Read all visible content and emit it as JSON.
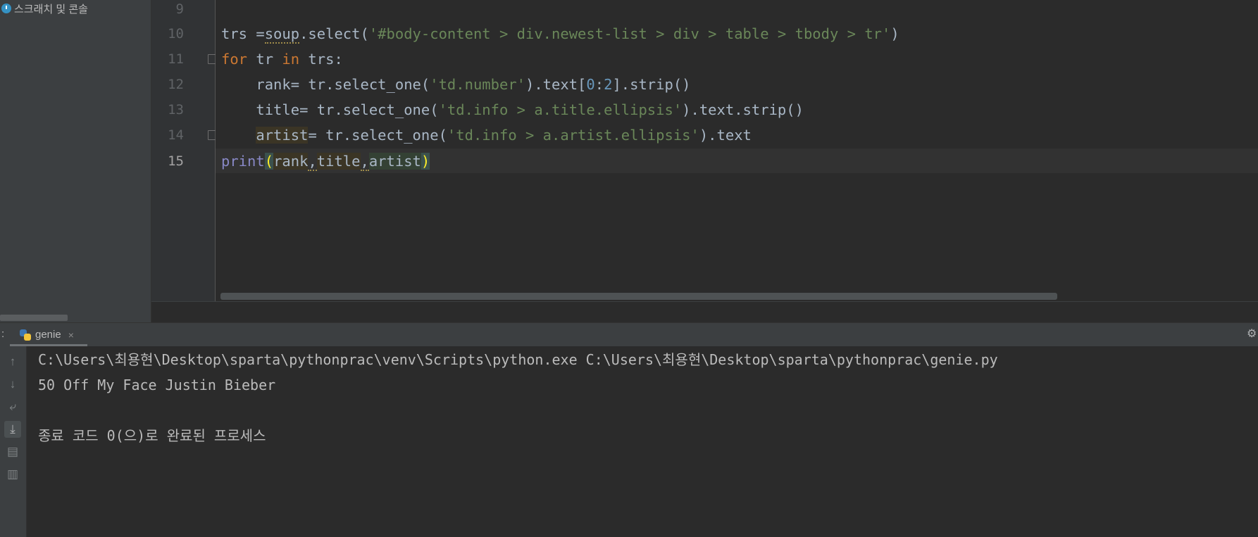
{
  "project": {
    "item_label": "스크래치 및 콘솔"
  },
  "gutter": {
    "line_numbers": [
      "9",
      "10",
      "11",
      "12",
      "13",
      "14",
      "15"
    ]
  },
  "editor": {
    "lines": [
      [
        "trs ",
        "=",
        "soup",
        ".select(",
        "'#body-content > div.newest-list > div > table > tbody > tr'",
        ")"
      ],
      [
        "for",
        " tr ",
        "in",
        " trs:"
      ],
      [
        "    ",
        "rank",
        "= tr.select_one(",
        "'td.number'",
        ").text[",
        "0",
        ":",
        "2",
        "].strip()"
      ],
      [
        "    ",
        "title",
        "= tr.select_one(",
        "'td.info > a.title.ellipsis'",
        ").text.strip()"
      ],
      [
        "    ",
        "artist",
        "= tr.select_one(",
        "'td.info > a.artist.ellipsis'",
        ").text"
      ],
      [
        "print",
        "(",
        "rank",
        ",",
        "title",
        ",",
        "artist",
        ")"
      ]
    ]
  },
  "run": {
    "colon": ":",
    "tab_label": "genie",
    "tab_close": "×",
    "console_lines": [
      "C:\\Users\\최용현\\Desktop\\sparta\\pythonprac\\venv\\Scripts\\python.exe C:\\Users\\최용현\\Desktop\\sparta\\pythonprac\\genie.py",
      "50 Off My Face Justin Bieber",
      "",
      "종료 코드 0(으)로 완료된 프로세스"
    ]
  },
  "icons": {
    "project_item": "scratches-clock-icon",
    "run_tab": "python-file-icon",
    "toolbar": [
      "rerun-up-icon",
      "down-arrow-icon",
      "soft-wrap-icon",
      "scroll-to-end-icon",
      "print-icon",
      "trash-icon"
    ],
    "settings": "gear-icon"
  },
  "colors": {
    "editor_bg": "#2b2b2b",
    "panel_bg": "#3c3f41",
    "keyword": "#cc7832",
    "string": "#6a8759",
    "number": "#6897bb",
    "builtin": "#8888c6",
    "bracket_match": "#ffef28"
  }
}
